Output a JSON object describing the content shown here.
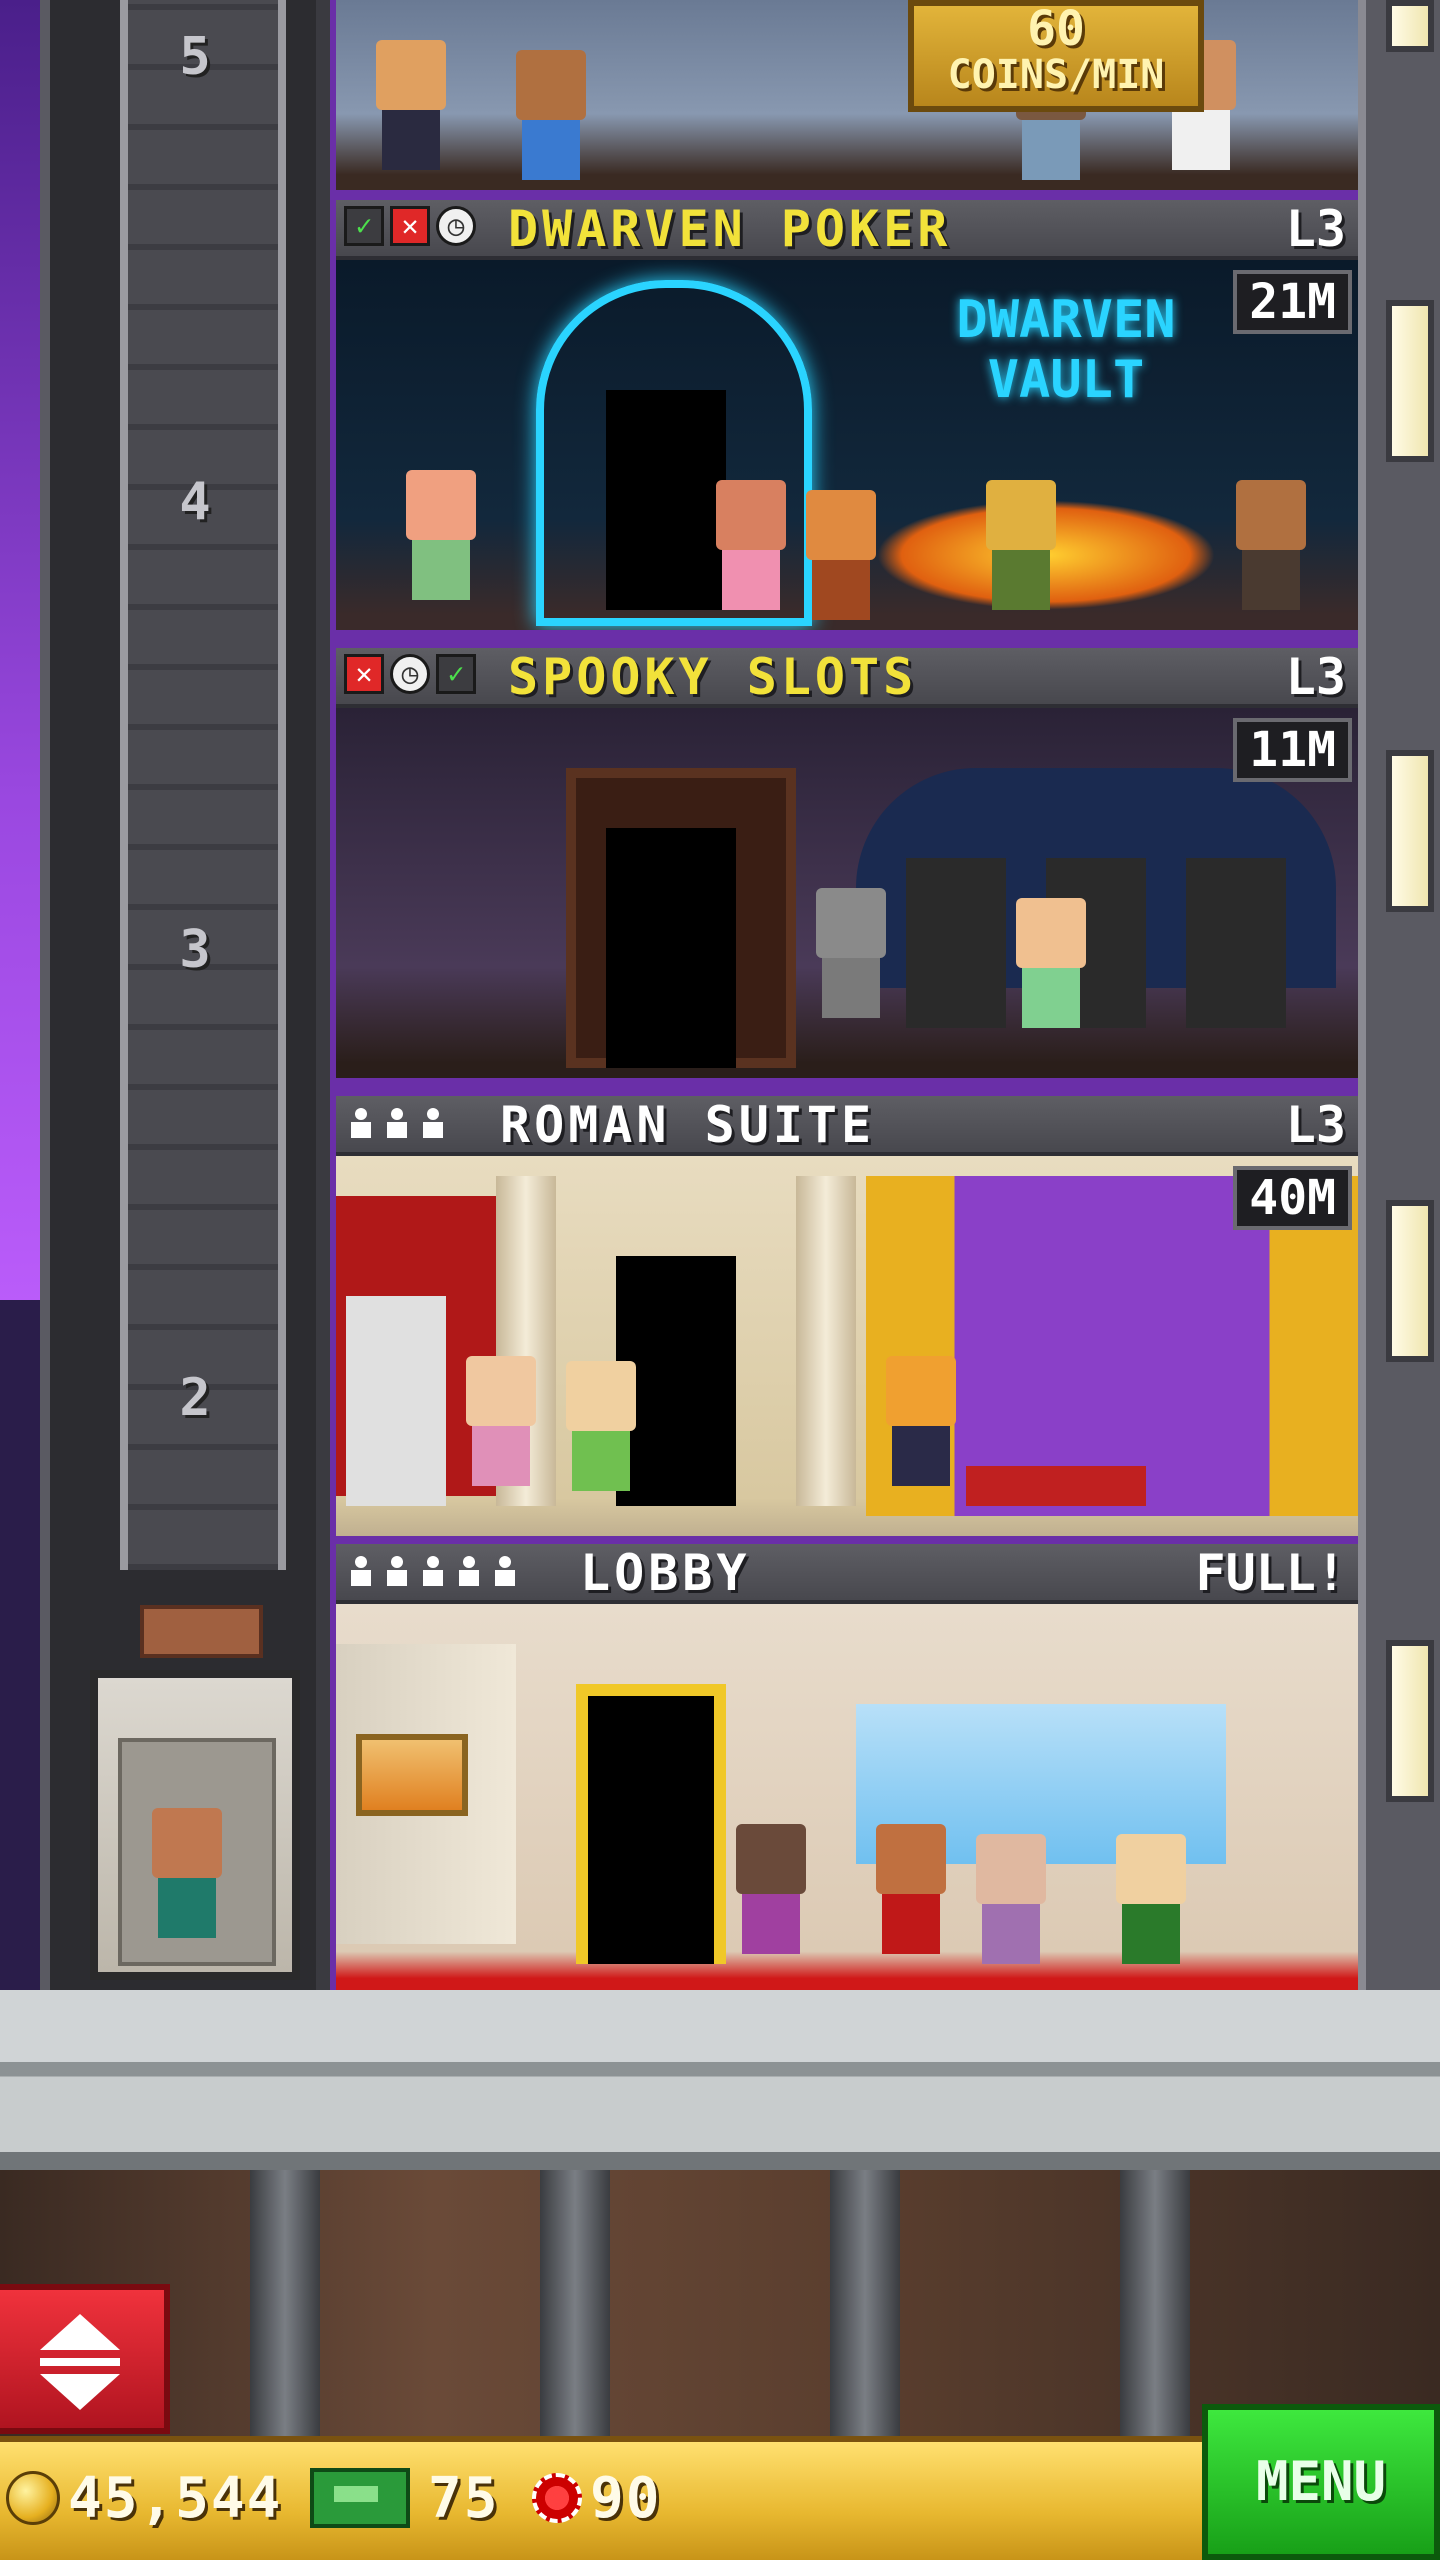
{
  "top_room": {
    "coins_per_min": "60",
    "coins_unit": "COINS/MIN"
  },
  "elevator": {
    "floor_numbers": [
      "5",
      "4",
      "3",
      "2"
    ]
  },
  "floors": [
    {
      "name": "DWARVEN POKER",
      "level": "L3",
      "stock": "21M",
      "name_color": "#f2e23a",
      "status_icons": [
        "check",
        "cross",
        "clock"
      ],
      "sign_text": "DWARVEN VAULT"
    },
    {
      "name": "SPOOKY SLOTS",
      "level": "L3",
      "stock": "11M",
      "name_color": "#f2e23a",
      "status_icons": [
        "cross",
        "clock",
        "check"
      ]
    },
    {
      "name": "ROMAN SUITE",
      "level": "L3",
      "stock": "40M",
      "name_color": "#ffffff",
      "residents": 3
    },
    {
      "name": "LOBBY",
      "level": "FULL!",
      "name_color": "#ffffff",
      "residents": 5
    }
  ],
  "hud": {
    "coins": "45,544",
    "bux": "75",
    "chips": "90",
    "menu_label": "MENU"
  }
}
